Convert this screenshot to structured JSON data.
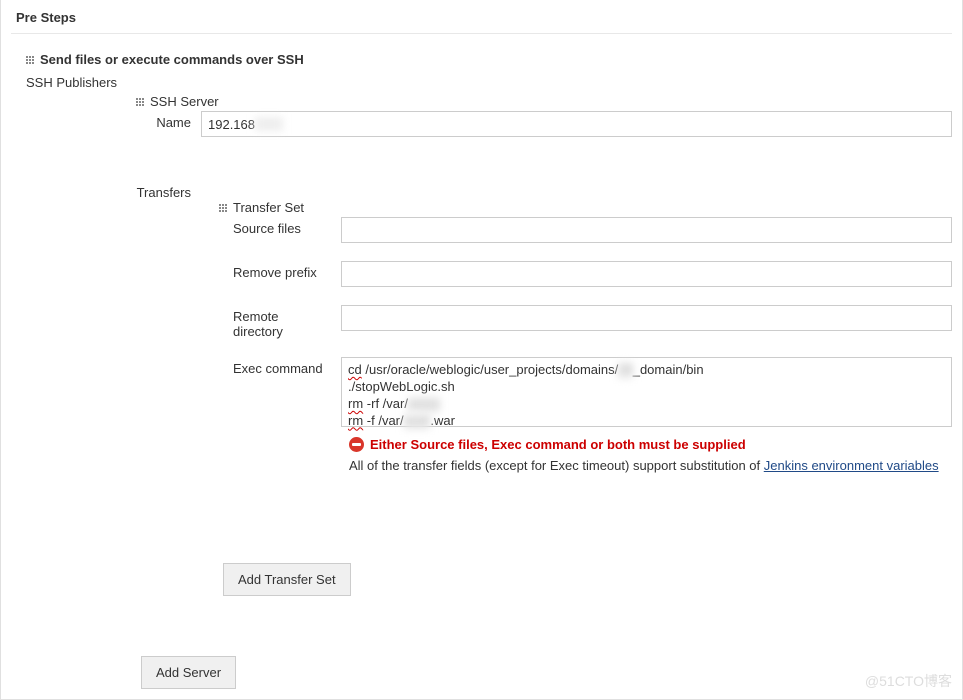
{
  "section": {
    "title": "Pre Steps"
  },
  "step": {
    "title": "Send files or execute commands over SSH"
  },
  "publishers": {
    "label": "SSH Publishers"
  },
  "server": {
    "header": "SSH Server",
    "name_label": "Name",
    "name_value": "192.168"
  },
  "transfers": {
    "label": "Transfers",
    "set_header": "Transfer Set",
    "source_files_label": "Source files",
    "source_files_value": "",
    "remove_prefix_label": "Remove prefix",
    "remove_prefix_value": "",
    "remote_directory_label": "Remote directory",
    "remote_directory_value": "",
    "exec_command_label": "Exec command",
    "exec_command": {
      "line1_prefix": "cd",
      "line1_path_a": " /usr/oracle/weblogic/user_projects/domains/",
      "line1_blur": "28",
      "line1_path_b": "_domain/bin",
      "line2": "./stopWebLogic.sh",
      "line3_prefix": "rm",
      "line3_rest": " -rf /var/",
      "line3_blur": "xxxxx",
      "line4_prefix": "rm",
      "line4_rest": " -f /var/",
      "line4_blur": "xxxh",
      "line4_suffix": ".war"
    }
  },
  "error": {
    "text": "Either Source files, Exec command or both must be supplied"
  },
  "help": {
    "prefix": "All of the transfer fields (except for Exec timeout) support substitution of ",
    "link": "Jenkins environment variables"
  },
  "buttons": {
    "add_transfer_set": "Add Transfer Set",
    "add_server": "Add Server"
  },
  "watermark": "@51CTO博客"
}
